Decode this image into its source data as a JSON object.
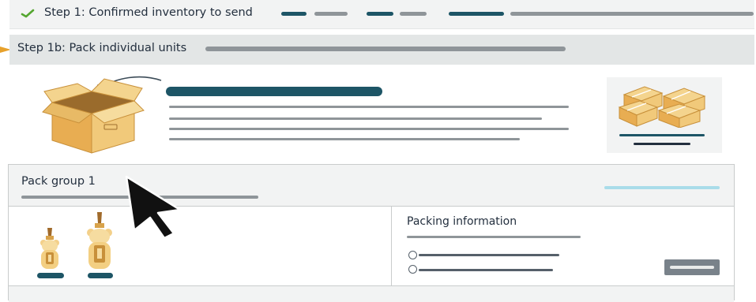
{
  "steps": {
    "step1_label": "Step 1: Confirmed inventory to send",
    "step1b_label": "Step 1b: Pack individual units"
  },
  "pack_group": {
    "title": "Pack group 1",
    "packing_information_label": "Packing information"
  },
  "icons": {
    "step_check": "check-icon",
    "pointer": "orange-arrow-icon",
    "cursor": "mouse-cursor-icon"
  },
  "colors": {
    "accent_teal": "#1d5566",
    "check_green": "#55a630",
    "pointer_orange": "#e7a12c",
    "link_blue": "#a9dce9",
    "box_tan": "#f1c97a"
  }
}
